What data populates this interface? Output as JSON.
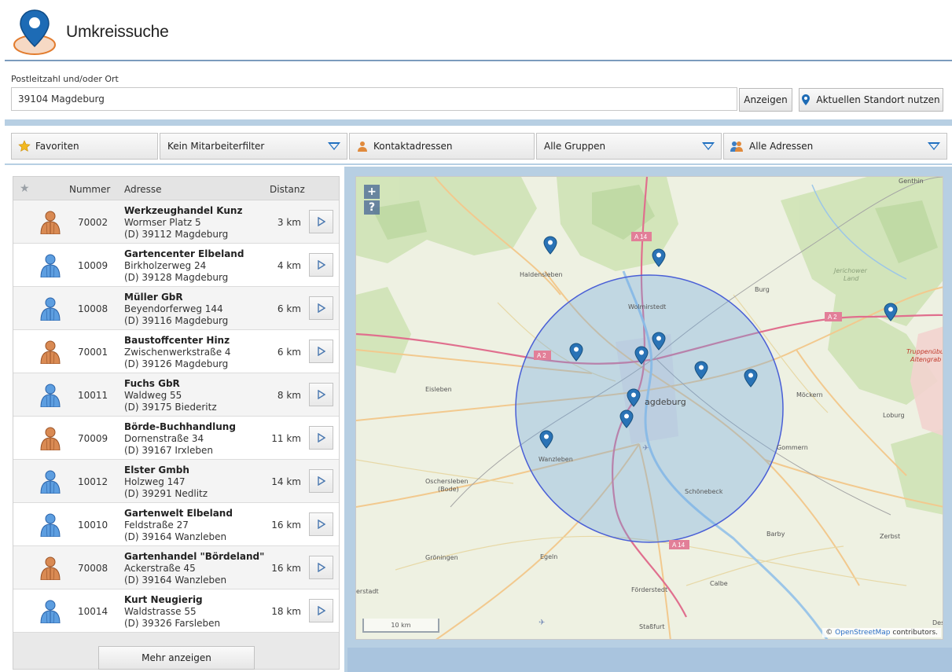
{
  "header": {
    "title": "Umkreissuche",
    "logo_icon": "map-pin-icon"
  },
  "search": {
    "label": "Postleitzahl und/oder Ort",
    "value": "39104 Magdeburg",
    "show_button": "Anzeigen",
    "location_button": "Aktuellen Standort nutzen"
  },
  "filters": {
    "favorites": "Favoriten",
    "employee_filter": "Kein Mitarbeiterfilter",
    "contacts": "Kontaktadressen",
    "groups": "Alle Gruppen",
    "addresses": "Alle Adressen"
  },
  "list": {
    "headers": {
      "number": "Nummer",
      "address": "Adresse",
      "distance": "Distanz"
    },
    "rows": [
      {
        "type": "brown",
        "number": "70002",
        "name": "Werkzeughandel Kunz",
        "street": "Wormser Platz 5",
        "city": "(D) 39112 Magdeburg",
        "distance": "3 km"
      },
      {
        "type": "blue",
        "number": "10009",
        "name": "Gartencenter Elbeland",
        "street": "Birkholzerweg 24",
        "city": "(D) 39128 Magdeburg",
        "distance": "4 km"
      },
      {
        "type": "blue",
        "number": "10008",
        "name": "Müller GbR",
        "street": "Beyendorferweg 144",
        "city": "(D) 39116 Magdeburg",
        "distance": "6 km"
      },
      {
        "type": "brown",
        "number": "70001",
        "name": "Baustoffcenter Hinz",
        "street": "Zwischenwerkstraße 4",
        "city": "(D) 39126 Magdeburg",
        "distance": "6 km"
      },
      {
        "type": "blue",
        "number": "10011",
        "name": "Fuchs GbR",
        "street": "Waldweg 55",
        "city": "(D) 39175 Biederitz",
        "distance": "8 km"
      },
      {
        "type": "brown",
        "number": "70009",
        "name": "Börde-Buchhandlung",
        "street": "Dornenstraße 34",
        "city": "(D) 39167 Irxleben",
        "distance": "11 km"
      },
      {
        "type": "blue",
        "number": "10012",
        "name": "Elster Gmbh",
        "street": "Holzweg 147",
        "city": "(D) 39291 Nedlitz",
        "distance": "14 km"
      },
      {
        "type": "blue",
        "number": "10010",
        "name": "Gartenwelt Elbeland",
        "street": "Feldstraße 27",
        "city": "(D) 39164 Wanzleben",
        "distance": "16 km"
      },
      {
        "type": "brown",
        "number": "70008",
        "name": "Gartenhandel \"Bördeland\"",
        "street": "Ackerstraße 45",
        "city": "(D) 39164 Wanzleben",
        "distance": "16 km"
      },
      {
        "type": "blue",
        "number": "10014",
        "name": "Kurt Neugierig",
        "street": "Waldstrasse 55",
        "city": "(D) 39326 Farsleben",
        "distance": "18 km"
      }
    ],
    "more_button": "Mehr anzeigen"
  },
  "map": {
    "zoom_in": "+",
    "help": "?",
    "scale": "10 km",
    "attribution_prefix": "©",
    "attribution_link": "OpenStreetMap",
    "attribution_suffix": "contributors.",
    "labels": {
      "genthin": "Genthin",
      "haldensleben": "Haldensleben",
      "a14": "A 14",
      "a14b": "A 14",
      "a2": "A 2",
      "a2b": "A 2",
      "wolmirstedt": "Wolmirstedt",
      "burg": "Burg",
      "jerichower": "Jerichower",
      "land": "Land",
      "eisleben": "Eisleben",
      "magdeburg": "agdeburg",
      "moeckern": "Möckern",
      "loburg": "Loburg",
      "truppen": "Truppenübun",
      "altengrab": "Altengrab",
      "wanzleben": "Wanzleben",
      "gommern": "Gommern",
      "oschersleben": "Oschersleben",
      "bode": "(Bode)",
      "schoenebeck": "Schönebeck",
      "barby": "Barby",
      "zerbst": "Zerbst",
      "groeningen": "Gröningen",
      "egeln": "Egeln",
      "calbe": "Calbe",
      "foerderstedt": "Förderstedt",
      "stassfurt": "Staßfurt",
      "erstadt": "erstadt",
      "dess": "Des"
    }
  },
  "colors": {
    "accent": "#1f6fc0",
    "pin": "#2a73b6",
    "circle": "#4a5fd6",
    "separator": "#b7cfe3"
  }
}
